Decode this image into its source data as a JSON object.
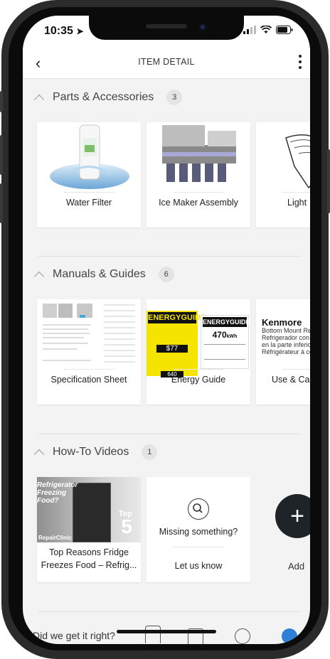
{
  "status_bar": {
    "time": "10:35"
  },
  "header": {
    "title": "ITEM DETAIL"
  },
  "sections": [
    {
      "title": "Parts & Accessories",
      "count": "3",
      "cards": [
        {
          "label": "Water Filter",
          "image": "water-filter-image"
        },
        {
          "label": "Ice Maker Assembly",
          "image": "ice-maker-image"
        },
        {
          "label": "Light",
          "image": "light-part-image"
        }
      ]
    },
    {
      "title": "Manuals & Guides",
      "count": "6",
      "cards": [
        {
          "label": "Specification Sheet",
          "image": "spec-sheet-image"
        },
        {
          "label": "Energy Guide",
          "image": "energy-guide-image"
        },
        {
          "label": "Use & Ca",
          "image": "use-care-image"
        }
      ],
      "energy_guide": {
        "brand": "ENERGYGUIDE",
        "cost": "$77",
        "kwh": "470",
        "kwh_unit": "kWh",
        "year": "640"
      },
      "kenmore": {
        "brand": "Kenmore",
        "line1": "Bottom Mount Refrige",
        "line2": "Refrigerador con con",
        "line3": "en la parte inferior",
        "line4": "Réfrigérateur à conge"
      }
    },
    {
      "title": "How-To Videos",
      "count": "1",
      "video": {
        "title": "Top Reasons Fridge Freezes Food – Refrig...",
        "overlay_text": "Refrigerator Freezing Food?",
        "top_label": "Top",
        "top_number": "5",
        "brand": "RepairClinic"
      },
      "missing": {
        "question": "Missing something?",
        "link": "Let us know"
      },
      "add_label": "Add"
    }
  ],
  "bottom": {
    "prompt": "Did we get it right?"
  },
  "colors": {
    "accent": "#1f2428",
    "background": "#f3f3f3",
    "badge": "#e4e4e4",
    "energy_yellow": "#f4e400"
  }
}
